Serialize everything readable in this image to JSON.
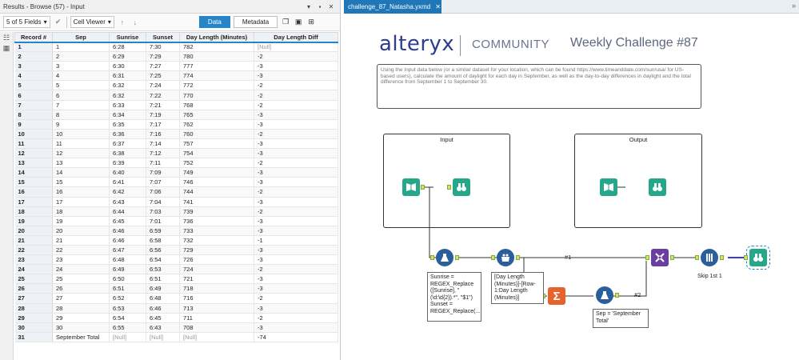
{
  "results": {
    "title": "Results - Browse (57) - Input",
    "title_controls": [
      "▾",
      "▪",
      "✕"
    ],
    "fields_select": "5 of 5 Fields",
    "cell_viewer": "Cell Viewer",
    "data_tab": "Data",
    "metadata_tab": "Metadata",
    "columns": [
      "Record #",
      "Sep",
      "Sunrise",
      "Sunset",
      "Day Length (Minutes)",
      "Day Length Diff"
    ],
    "rows": [
      [
        "1",
        "1",
        "6:28",
        "7:30",
        "782",
        "[Null]"
      ],
      [
        "2",
        "2",
        "6:29",
        "7:29",
        "780",
        "-2"
      ],
      [
        "3",
        "3",
        "6:30",
        "7:27",
        "777",
        "-3"
      ],
      [
        "4",
        "4",
        "6:31",
        "7:25",
        "774",
        "-3"
      ],
      [
        "5",
        "5",
        "6:32",
        "7:24",
        "772",
        "-2"
      ],
      [
        "6",
        "6",
        "6:32",
        "7:22",
        "770",
        "-2"
      ],
      [
        "7",
        "7",
        "6:33",
        "7:21",
        "768",
        "-2"
      ],
      [
        "8",
        "8",
        "6:34",
        "7:19",
        "765",
        "-3"
      ],
      [
        "9",
        "9",
        "6:35",
        "7:17",
        "762",
        "-3"
      ],
      [
        "10",
        "10",
        "6:36",
        "7:16",
        "760",
        "-2"
      ],
      [
        "11",
        "11",
        "6:37",
        "7:14",
        "757",
        "-3"
      ],
      [
        "12",
        "12",
        "6:38",
        "7:12",
        "754",
        "-3"
      ],
      [
        "13",
        "13",
        "6:39",
        "7:11",
        "752",
        "-2"
      ],
      [
        "14",
        "14",
        "6:40",
        "7:09",
        "749",
        "-3"
      ],
      [
        "15",
        "15",
        "6:41",
        "7:07",
        "746",
        "-3"
      ],
      [
        "16",
        "16",
        "6:42",
        "7:06",
        "744",
        "-2"
      ],
      [
        "17",
        "17",
        "6:43",
        "7:04",
        "741",
        "-3"
      ],
      [
        "18",
        "18",
        "6:44",
        "7:03",
        "739",
        "-2"
      ],
      [
        "19",
        "19",
        "6:45",
        "7:01",
        "736",
        "-3"
      ],
      [
        "20",
        "20",
        "6:46",
        "6:59",
        "733",
        "-3"
      ],
      [
        "21",
        "21",
        "6:46",
        "6:58",
        "732",
        "-1"
      ],
      [
        "22",
        "22",
        "6:47",
        "6:56",
        "729",
        "-3"
      ],
      [
        "23",
        "23",
        "6:48",
        "6:54",
        "726",
        "-3"
      ],
      [
        "24",
        "24",
        "6:49",
        "6:53",
        "724",
        "-2"
      ],
      [
        "25",
        "25",
        "6:50",
        "6:51",
        "721",
        "-3"
      ],
      [
        "26",
        "26",
        "6:51",
        "6:49",
        "718",
        "-3"
      ],
      [
        "27",
        "27",
        "6:52",
        "6:48",
        "716",
        "-2"
      ],
      [
        "28",
        "28",
        "6:53",
        "6:46",
        "713",
        "-3"
      ],
      [
        "29",
        "29",
        "6:54",
        "6:45",
        "711",
        "-2"
      ],
      [
        "30",
        "30",
        "6:55",
        "6:43",
        "708",
        "-3"
      ],
      [
        "31",
        "September Total",
        "[Null]",
        "[Null]",
        "[Null]",
        "-74"
      ]
    ]
  },
  "canvas": {
    "tab_title": "challenge_87_Natasha.yxmd",
    "tab_close": "✕",
    "logo": "alteryx",
    "community": "COMMUNITY",
    "challenge": "Weekly Challenge #87",
    "description": "Using the Input data below (or a similar dataset for your location, which can be found https://www.timeanddate.com/sun/usa/ for US-based users), calculate the amount of daylight for each day in September, as well as the day-to-day differences in daylight and the total difference from September 1 to September 30.",
    "input_label": "Input",
    "output_label": "Output",
    "formula1_annotation": "Sunrise = REGEX_Replace ([Sunrise], \"(\\d:\\d{2}).*\", \"$1\") Sunset = REGEX_Replace(...",
    "multirow_annotation": "[Day Length (Minutes)]-[Row-1:Day Length (Minutes)]",
    "formula2_annotation": "Sep = 'September Total'",
    "sample_annotation": "Skip 1st 1",
    "conn1": "#1",
    "conn2": "#2",
    "colors": {
      "accent": "#2585c6",
      "tab": "#1f77b8",
      "green_tool": "#25a78a",
      "blue_tool": "#2b5f9c",
      "orange_tool": "#e8632b",
      "purple_tool": "#6a3fa0"
    }
  }
}
